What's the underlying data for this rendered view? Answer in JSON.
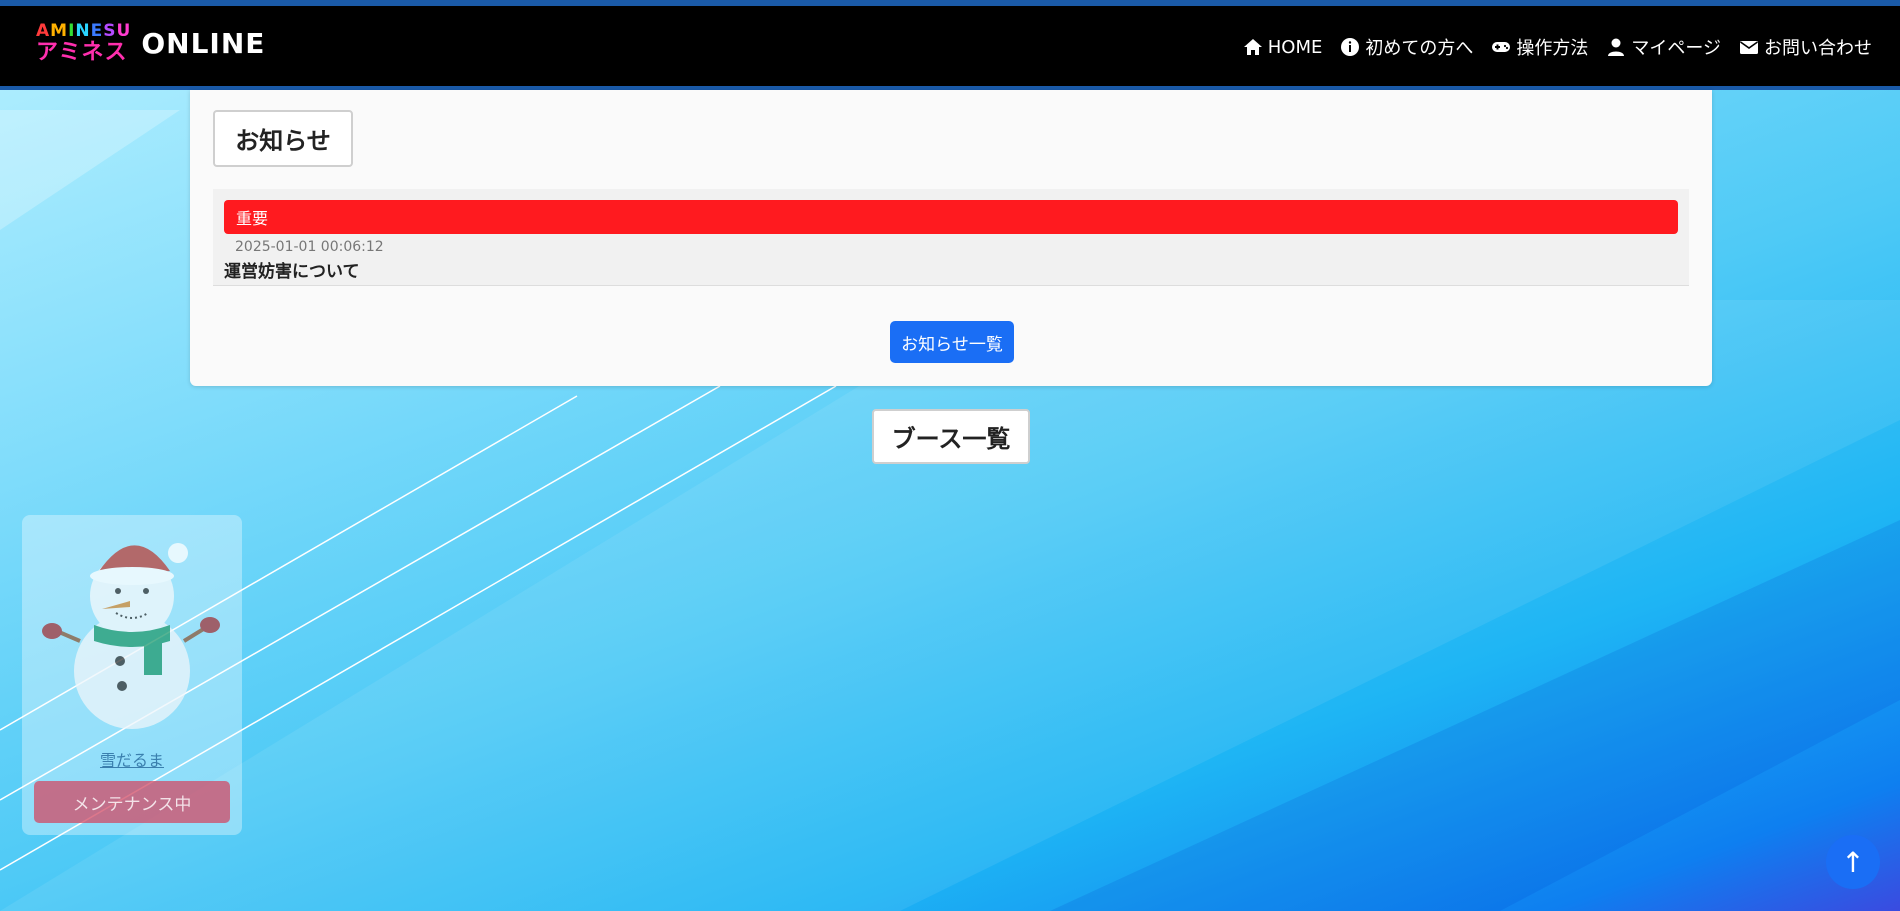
{
  "header": {
    "logo_en_letters": [
      {
        "char": "A",
        "color": "#ff3b3b"
      },
      {
        "char": "M",
        "color": "#ffb100"
      },
      {
        "char": "I",
        "color": "#33dd33"
      },
      {
        "char": "N",
        "color": "#2ad4ff"
      },
      {
        "char": "E",
        "color": "#3b7bff"
      },
      {
        "char": "S",
        "color": "#b44bff"
      },
      {
        "char": "U",
        "color": "#ff3bd0"
      }
    ],
    "logo_jp": "アミネス",
    "logo_online": "ONLINE",
    "nav": [
      {
        "label": "HOME",
        "icon": "home-icon"
      },
      {
        "label": "初めての方へ",
        "icon": "info-icon"
      },
      {
        "label": "操作方法",
        "icon": "gamepad-icon"
      },
      {
        "label": "マイページ",
        "icon": "user-icon"
      },
      {
        "label": "お問い合わせ",
        "icon": "mail-icon"
      }
    ]
  },
  "news": {
    "title": "お知らせ",
    "items": [
      {
        "badge": "重要",
        "date": "2025-01-01 00:06:12",
        "text": "運営妨害について"
      }
    ],
    "list_button": "お知らせ一覧"
  },
  "booths": {
    "title": "ブース一覧",
    "items": [
      {
        "name": "雪だるま",
        "status": "メンテナンス中"
      }
    ]
  },
  "to_top": "↑",
  "colors": {
    "accent": "#1a6ef5",
    "important": "#ff1a1f",
    "maintenance": "#d14a64"
  }
}
